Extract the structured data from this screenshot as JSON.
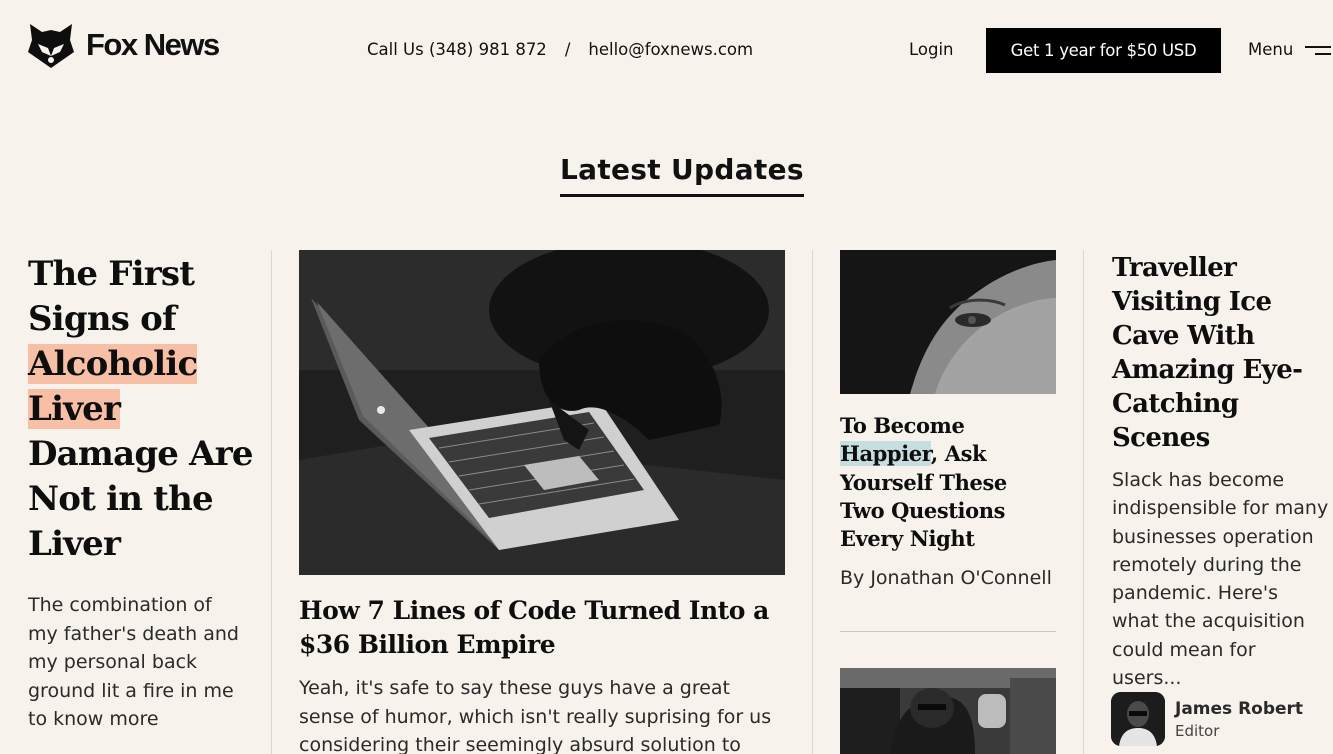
{
  "header": {
    "brand": "Fox News",
    "phone": "Call Us (348) 981 872",
    "separator": "/",
    "email": "hello@foxnews.com",
    "login": "Login",
    "cta": "Get 1 year for $50 USD",
    "menu": "Menu"
  },
  "section": {
    "title": "Latest Updates"
  },
  "articles": [
    {
      "title_pre": "The First Signs of",
      "title_highlight": "Alcoholic Liver",
      "title_post": "Damage Are Not in the Liver",
      "excerpt": "The combination of my father's death and my personal back ground lit a fire in me to know more",
      "highlight_color": "#f7c0a6"
    },
    {
      "image": "laptop-photo",
      "title": "How 7 Lines of Code Turned Into a $36 Billion Empire",
      "excerpt": "Yeah, it's safe to say these guys have a great sense of humor, which isn't really suprising for us considering their seemingly absurd solution to"
    },
    {
      "image": "face-photo",
      "title_pre": "To Become",
      "title_highlight": "Happier",
      "title_post": ", Ask Yourself These Two Questions Every Night",
      "byline": "By Jonathan O'Connell",
      "highlight_color": "#c6dedf"
    },
    {
      "title": "Traveller Visiting Ice Cave With Amazing Eye-Catching Scenes",
      "excerpt": "Slack has become indispensible for many businesses operation remotely during the pandemic. Here's what the acquisition could mean for users...",
      "author": {
        "name": "James Robert",
        "role": "Editor"
      }
    }
  ],
  "colors": {
    "background": "#f7f3ec",
    "cta_bg": "#000000",
    "text": "#111111"
  }
}
